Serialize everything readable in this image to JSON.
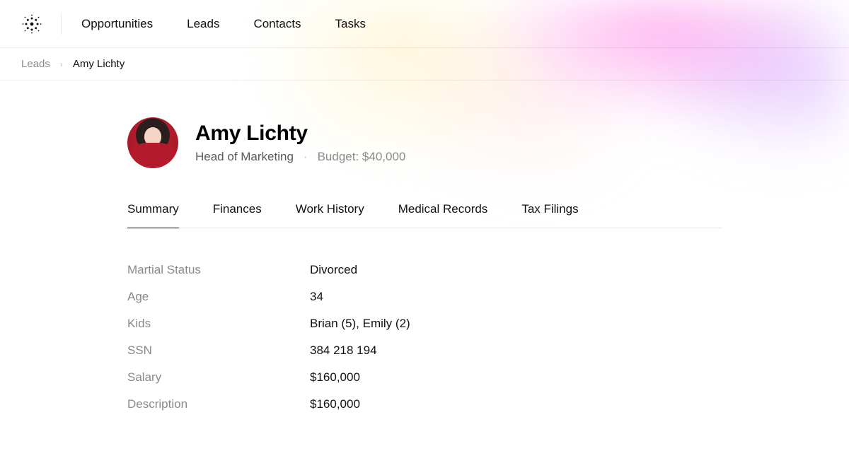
{
  "nav": {
    "items": [
      "Opportunities",
      "Leads",
      "Contacts",
      "Tasks"
    ]
  },
  "breadcrumb": {
    "parent": "Leads",
    "current": "Amy Lichty"
  },
  "profile": {
    "name": "Amy Lichty",
    "role": "Head of Marketing",
    "budget": "Budget: $40,000"
  },
  "tabs": {
    "items": [
      "Summary",
      "Finances",
      "Work History",
      "Medical Records",
      "Tax Filings"
    ],
    "active": 0
  },
  "details": [
    {
      "label": "Martial Status",
      "value": "Divorced"
    },
    {
      "label": "Age",
      "value": "34"
    },
    {
      "label": "Kids",
      "value": "Brian (5), Emily (2)"
    },
    {
      "label": "SSN",
      "value": "384 218 194"
    },
    {
      "label": "Salary",
      "value": "$160,000"
    },
    {
      "label": "Description",
      "value": "$160,000"
    }
  ]
}
